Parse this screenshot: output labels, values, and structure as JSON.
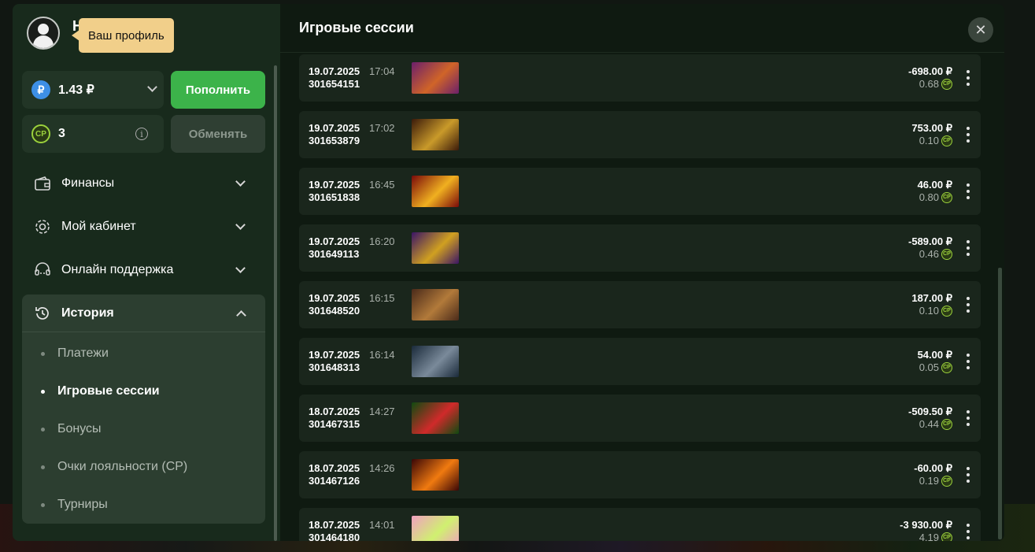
{
  "tooltip": {
    "text": "Ваш профиль"
  },
  "user": {
    "name_peek": "H"
  },
  "wallet": {
    "balance": "1.43 ₽",
    "currency_symbol": "₽",
    "cp_points": "3",
    "cp_label": "CP",
    "info_symbol": "i",
    "topup_label": "Пополнить",
    "exchange_label": "Обменять"
  },
  "menu": {
    "items": [
      {
        "label": "Финансы",
        "icon": "wallet-icon"
      },
      {
        "label": "Мой кабинет",
        "icon": "gear-icon"
      },
      {
        "label": "Онлайн поддержка",
        "icon": "headset-icon"
      }
    ],
    "history": {
      "label": "История",
      "icon": "history-icon",
      "sub_items": [
        {
          "label": "Платежи",
          "active": false
        },
        {
          "label": "Игровые сессии",
          "active": true
        },
        {
          "label": "Бонусы",
          "active": false
        },
        {
          "label": "Очки лояльности (CP)",
          "active": false
        },
        {
          "label": "Турниры",
          "active": false
        }
      ]
    }
  },
  "sessions": {
    "title": "Игровые сессии",
    "close_symbol": "✕",
    "cp_badge": "CP",
    "rows": [
      {
        "date": "19.07.2025",
        "time": "17:04",
        "id": "301654151",
        "amount": "-698.00 ₽",
        "cp": "0.68",
        "thumb": [
          "#6b1f6b",
          "#d06428"
        ]
      },
      {
        "date": "19.07.2025",
        "time": "17:02",
        "id": "301653879",
        "amount": "753.00 ₽",
        "cp": "0.10",
        "thumb": [
          "#3b1a0a",
          "#c99a2a"
        ]
      },
      {
        "date": "19.07.2025",
        "time": "16:45",
        "id": "301651838",
        "amount": "46.00 ₽",
        "cp": "0.80",
        "thumb": [
          "#7a0a0a",
          "#f0b020"
        ]
      },
      {
        "date": "19.07.2025",
        "time": "16:20",
        "id": "301649113",
        "amount": "-589.00 ₽",
        "cp": "0.46",
        "thumb": [
          "#3a1466",
          "#d0a020"
        ]
      },
      {
        "date": "19.07.2025",
        "time": "16:15",
        "id": "301648520",
        "amount": "187.00 ₽",
        "cp": "0.10",
        "thumb": [
          "#4a2a1a",
          "#b27a3a"
        ]
      },
      {
        "date": "19.07.2025",
        "time": "16:14",
        "id": "301648313",
        "amount": "54.00 ₽",
        "cp": "0.05",
        "thumb": [
          "#1a2a3a",
          "#7a8a9a"
        ]
      },
      {
        "date": "18.07.2025",
        "time": "14:27",
        "id": "301467315",
        "amount": "-509.50 ₽",
        "cp": "0.44",
        "thumb": [
          "#0f4a10",
          "#d02a2a"
        ]
      },
      {
        "date": "18.07.2025",
        "time": "14:26",
        "id": "301467126",
        "amount": "-60.00 ₽",
        "cp": "0.19",
        "thumb": [
          "#3a0606",
          "#f07a10"
        ]
      },
      {
        "date": "18.07.2025",
        "time": "14:01",
        "id": "301464180",
        "amount": "-3 930.00 ₽",
        "cp": "4.19",
        "thumb": [
          "#f0a0c0",
          "#d0f070"
        ]
      }
    ]
  }
}
